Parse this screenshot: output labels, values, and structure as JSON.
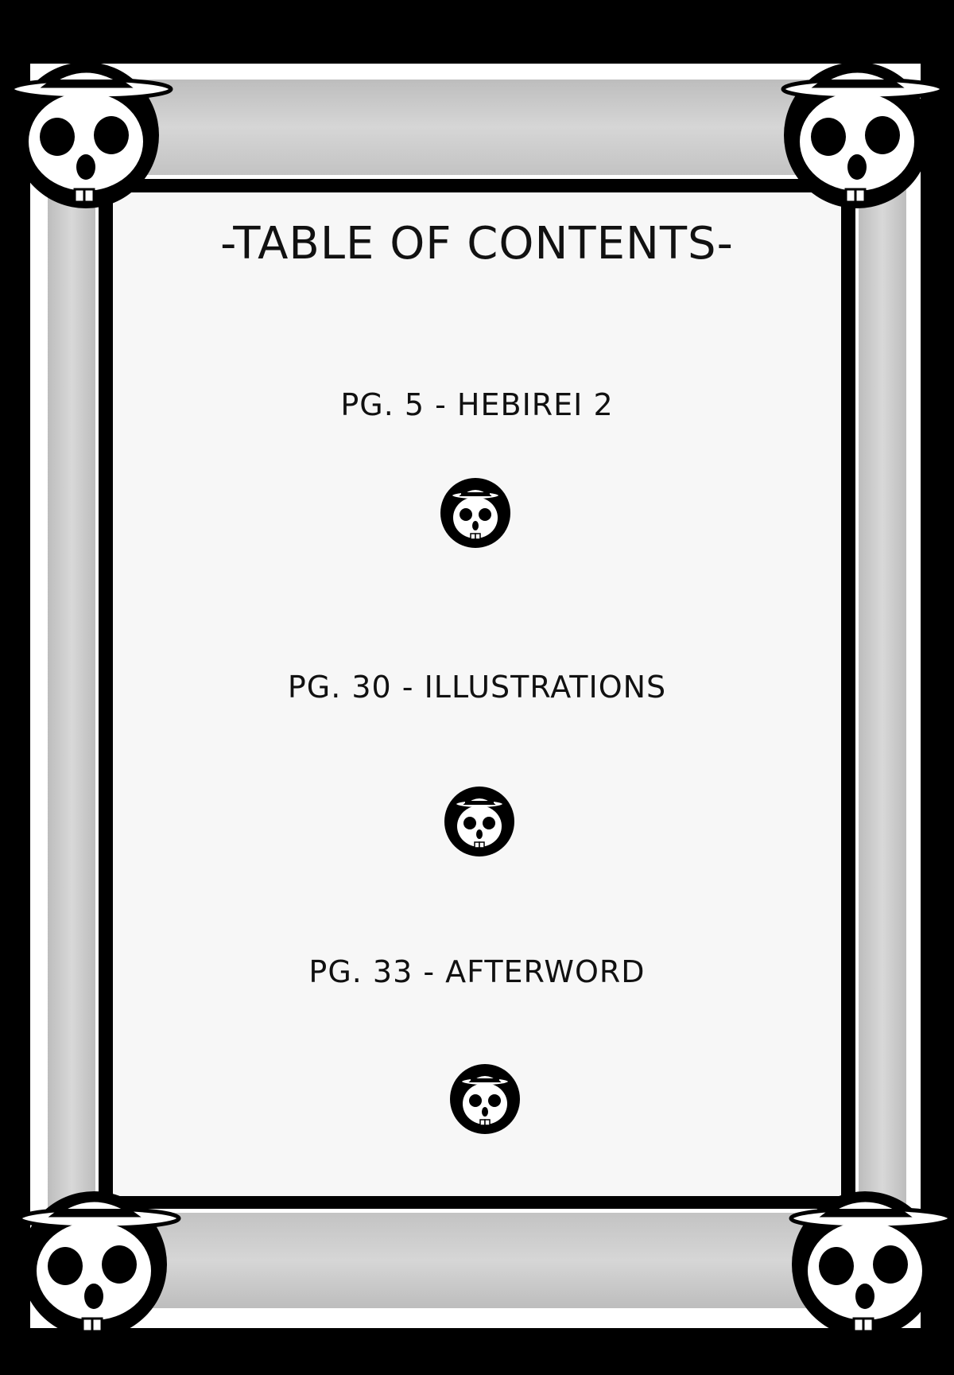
{
  "toc": {
    "title": "-TABLE OF CONTENTS-",
    "entries": [
      {
        "label": "PG. 5 - HEBIREI 2"
      },
      {
        "label": "PG. 30 - ILLUSTRATIONS"
      },
      {
        "label": "PG. 33 - AFTERWORD"
      }
    ]
  },
  "icons": {
    "corner": "skull-hat-icon",
    "separator": "skull-hat-icon"
  },
  "colors": {
    "ink": "#000000",
    "paper": "#f7f7f7",
    "frame_grey": "#c8c8c8"
  }
}
